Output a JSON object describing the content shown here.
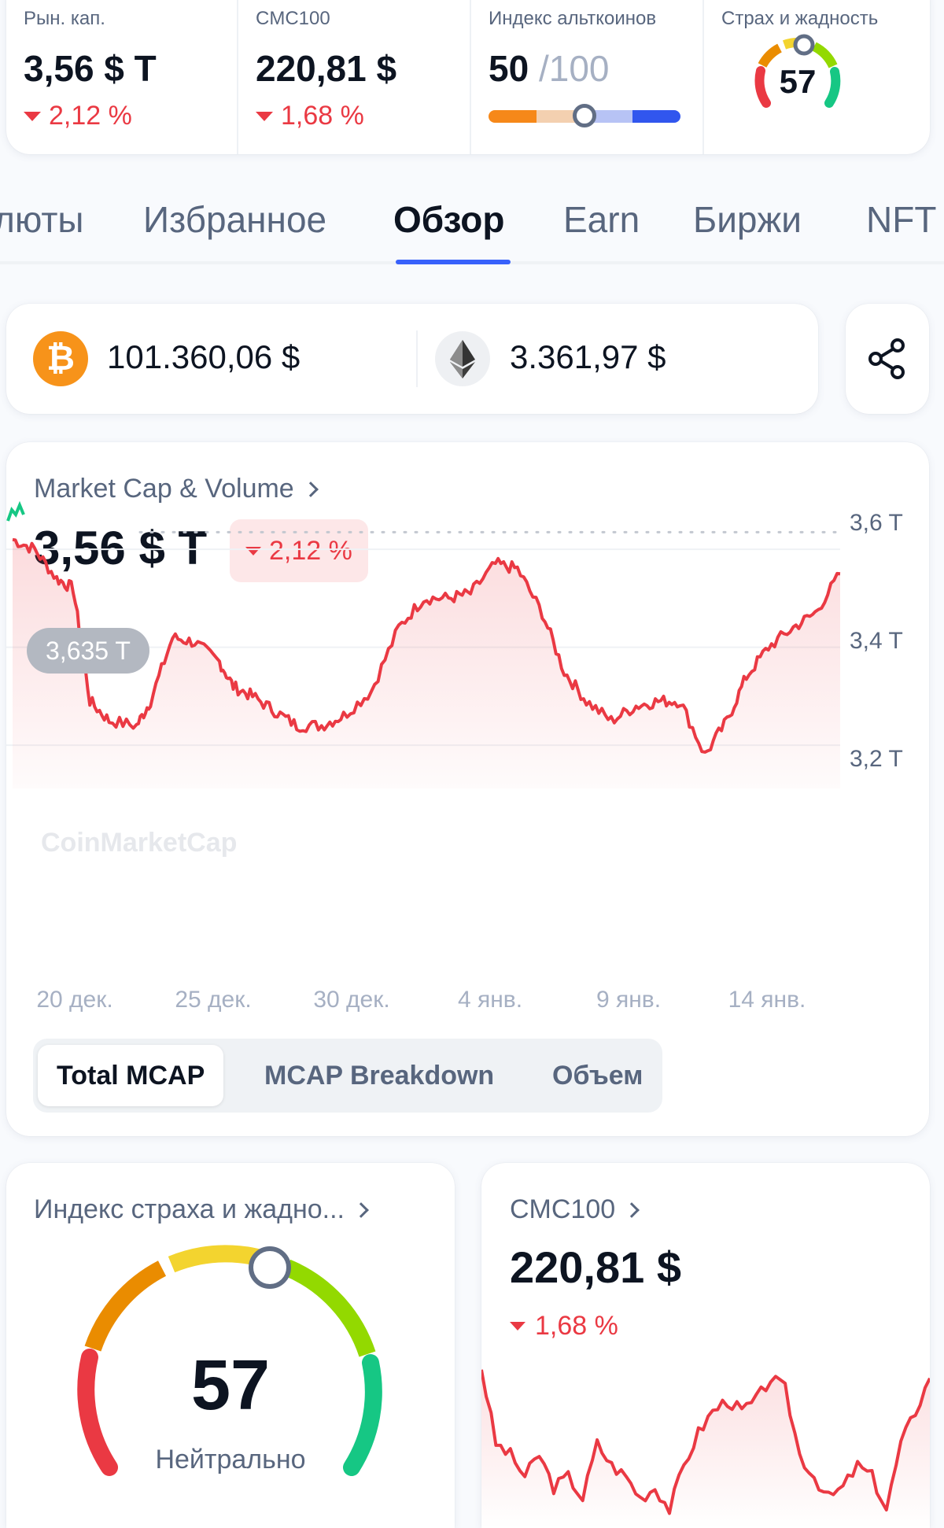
{
  "metrics": {
    "market_cap": {
      "label": "Рын. кап.",
      "value": "3,56 $ T",
      "change": "2,12 %"
    },
    "cmc100": {
      "label": "CMC100",
      "value": "220,81 $",
      "change": "1,68 %"
    },
    "altcoin_index": {
      "label": "Индекс альткоинов",
      "value": "50",
      "max": "/100",
      "level": 0.5
    },
    "fear_greed": {
      "label": "Страх и жадность",
      "value": "57"
    }
  },
  "tabs": [
    {
      "label": "люты"
    },
    {
      "label": "Избранное"
    },
    {
      "label": "Обзор",
      "active": true
    },
    {
      "label": "Earn"
    },
    {
      "label": "Биржи"
    },
    {
      "label": "NFT"
    }
  ],
  "prices": {
    "btc": {
      "icon": "bitcoin-icon",
      "glyph": "₿",
      "price": "101.360,06 $"
    },
    "eth": {
      "icon": "ethereum-icon",
      "price": "3.361,97 $"
    },
    "share_icon": "share-icon"
  },
  "mcap_card": {
    "title": "Market Cap & Volume",
    "value": "3,56 $ T",
    "change": "2,12 %",
    "hover_label": "3,635 T",
    "watermark": "CoinMarketCap",
    "segments": [
      {
        "label": "Total MCAP",
        "active": true
      },
      {
        "label": "MCAP Breakdown"
      },
      {
        "label": "Объем"
      }
    ]
  },
  "chart_data": [
    {
      "type": "area",
      "x_ticks": [
        "20 дек.",
        "25 дек.",
        "30 дек.",
        "4 янв.",
        "9 янв.",
        "14 янв."
      ],
      "y_ticks": [
        "3,6 T",
        "3,4 T",
        "3,2 T"
      ],
      "ylim": [
        3.16,
        3.65
      ],
      "reference_line": 3.635,
      "series": [
        {
          "color": "#ea3943",
          "x": [
            0,
            0.8,
            1.6,
            2.2,
            2.8,
            3.5,
            4.5,
            5.0,
            5.8,
            6.6,
            7.5,
            8.0,
            8.7,
            9.5,
            10.3,
            11.2,
            12.0,
            13.0,
            14.0,
            14.9,
            15.8,
            16.6,
            17.5,
            18.3,
            19.2,
            20.0,
            20.8,
            21.7,
            22.6,
            23.4,
            24.2,
            25.1,
            25.9,
            26.6,
            27.4,
            28.3,
            29.1,
            30.0
          ],
          "values": [
            3.62,
            3.6,
            3.54,
            3.52,
            3.29,
            3.25,
            3.24,
            3.29,
            3.42,
            3.41,
            3.37,
            3.32,
            3.3,
            3.27,
            3.24,
            3.24,
            3.26,
            3.31,
            3.44,
            3.5,
            3.5,
            3.51,
            3.57,
            3.56,
            3.47,
            3.35,
            3.29,
            3.25,
            3.28,
            3.29,
            3.29,
            3.18,
            3.25,
            3.34,
            3.4,
            3.44,
            3.47,
            3.55
          ]
        }
      ]
    },
    {
      "type": "line",
      "title": "CMC100",
      "series": [
        {
          "color": "#ea3943",
          "values": [
            229,
            222,
            221,
            219,
            221,
            218,
            219,
            217,
            222,
            220,
            219,
            217,
            218,
            216,
            220,
            223,
            225,
            226,
            225,
            226,
            228,
            227,
            221,
            219,
            217,
            218,
            220,
            219,
            216,
            222,
            225,
            228
          ]
        }
      ]
    }
  ],
  "fear_greed_card": {
    "title": "Индекс страха и жадно...",
    "value": "57",
    "label": "Нейтрально",
    "level": 0.57
  },
  "cmc100_card": {
    "title": "CMC100",
    "value": "220,81 $",
    "change": "1,68 %"
  },
  "colors": {
    "negative": "#ea3943",
    "accent": "#3861fb",
    "positive": "#16c784"
  }
}
